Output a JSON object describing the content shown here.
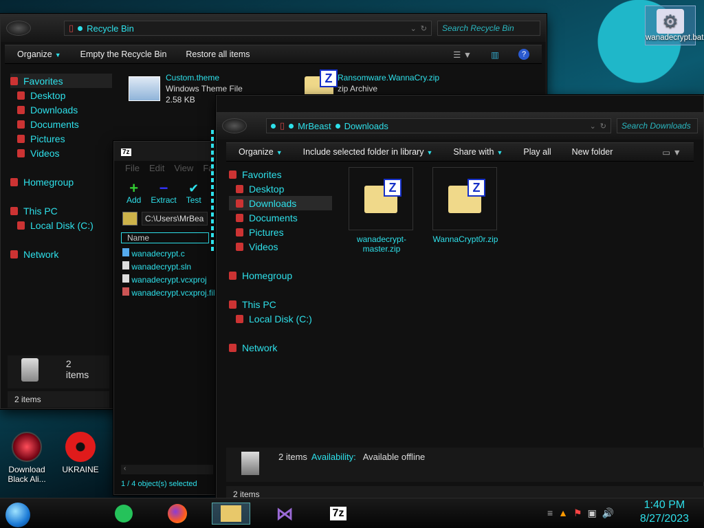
{
  "desktop": {
    "icons": [
      {
        "label": "Download Black Ali..."
      },
      {
        "label": "UKRAINE"
      },
      {
        "label": "wanadecrypt.bat"
      }
    ]
  },
  "recycle_window": {
    "title": "Recycle Bin",
    "search_placeholder": "Search Recycle Bin",
    "toolbar": {
      "organize": "Organize",
      "empty": "Empty the Recycle Bin",
      "restore": "Restore all items"
    },
    "nav": [
      "Favorites",
      "Desktop",
      "Downloads",
      "Documents",
      "Pictures",
      "Videos",
      "Homegroup",
      "This PC",
      "Local Disk (C:)",
      "Network"
    ],
    "files": [
      {
        "name": "Custom.theme",
        "type": "Windows Theme File",
        "size": "2.58 KB"
      },
      {
        "name": "Ransomware.WannaCry.zip",
        "type": "zip Archive"
      }
    ],
    "details_count": "2 items",
    "status": "2 items"
  },
  "sevenzip_window": {
    "app_icon": "7z",
    "menu": [
      "File",
      "Edit",
      "View",
      "Fa"
    ],
    "toolbar": [
      {
        "label": "Add"
      },
      {
        "label": "Extract"
      },
      {
        "label": "Test"
      }
    ],
    "path": "C:\\Users\\MrBea",
    "column": "Name",
    "files": [
      "wanadecrypt.c",
      "wanadecrypt.sln",
      "wanadecrypt.vcxproj",
      "wanadecrypt.vcxproj.fil"
    ],
    "status": "1 / 4 object(s) selected"
  },
  "downloads_window": {
    "breadcrumb": [
      "MrBeast",
      "Downloads"
    ],
    "search_placeholder": "Search Downloads",
    "toolbar": {
      "organize": "Organize",
      "include": "Include selected folder in library",
      "share": "Share with",
      "play": "Play all",
      "newfolder": "New folder"
    },
    "nav": [
      "Favorites",
      "Desktop",
      "Downloads",
      "Documents",
      "Pictures",
      "Videos",
      "Homegroup",
      "This PC",
      "Local Disk (C:)",
      "Network"
    ],
    "files": [
      {
        "name": "wanadecrypt-master.zip"
      },
      {
        "name": "WannaCrypt0r.zip"
      }
    ],
    "details": {
      "count": "2 items",
      "availability_label": "Availability:",
      "availability": "Available offline"
    },
    "status": "2 items"
  },
  "taskbar": {
    "apps": [
      "notes",
      "firefox",
      "explorer",
      "visual-studio",
      "7zip"
    ],
    "sevenzip_label": "7z",
    "clock": {
      "time": "1:40 PM",
      "date": "8/27/2023"
    }
  },
  "colors": {
    "accent": "#2ee0ea",
    "window_bg": "#111111",
    "zip_yellow": "#f0d98a"
  }
}
